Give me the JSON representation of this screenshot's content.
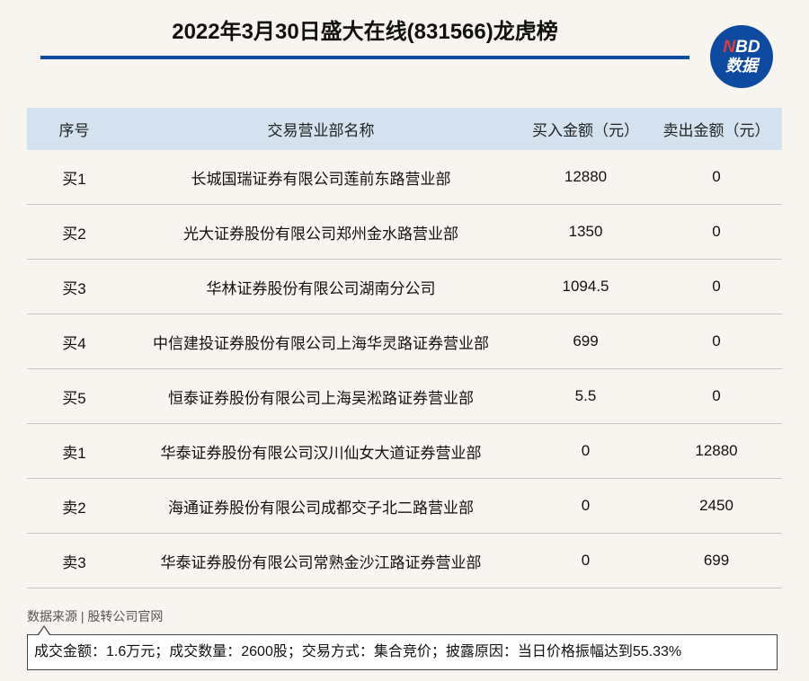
{
  "title": "2022年3月30日盛大在线(831566)龙虎榜",
  "logo": {
    "line1_n": "N",
    "line1_rest": "BD",
    "line2": "数据"
  },
  "table": {
    "headers": [
      "序号",
      "交易营业部名称",
      "买入金额（元）",
      "卖出金额（元）"
    ],
    "rows": [
      [
        "买1",
        "长城国瑞证券有限公司莲前东路营业部",
        "12880",
        "0"
      ],
      [
        "买2",
        "光大证券股份有限公司郑州金水路营业部",
        "1350",
        "0"
      ],
      [
        "买3",
        "华林证券股份有限公司湖南分公司",
        "1094.5",
        "0"
      ],
      [
        "买4",
        "中信建投证券股份有限公司上海华灵路证券营业部",
        "699",
        "0"
      ],
      [
        "买5",
        "恒泰证券股份有限公司上海吴淞路证券营业部",
        "5.5",
        "0"
      ],
      [
        "卖1",
        "华泰证券股份有限公司汉川仙女大道证券营业部",
        "0",
        "12880"
      ],
      [
        "卖2",
        "海通证券股份有限公司成都交子北二路营业部",
        "0",
        "2450"
      ],
      [
        "卖3",
        "华泰证券股份有限公司常熟金沙江路证券营业部",
        "0",
        "699"
      ]
    ]
  },
  "source": "数据来源 | 股转公司官网",
  "note": "成交金额：1.6万元；成交数量：2600股；交易方式：集合竞价；披露原因：当日价格振幅达到55.33%"
}
